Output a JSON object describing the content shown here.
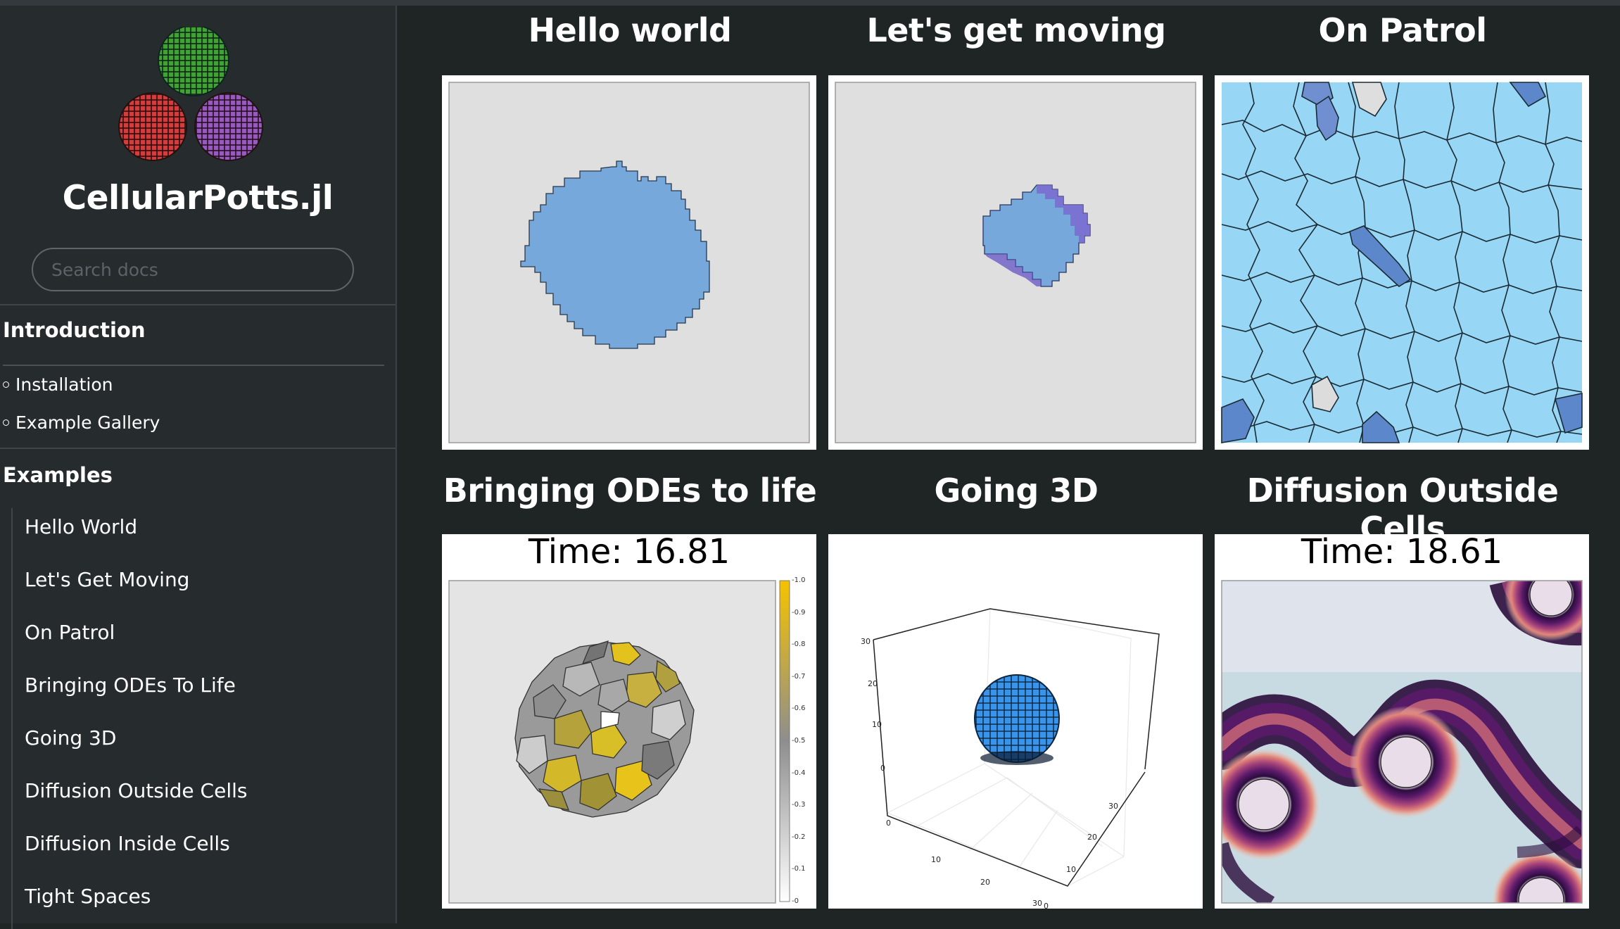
{
  "sidebar": {
    "package_name": "CellularPotts.jl",
    "search_placeholder": "Search docs",
    "intro": {
      "title": "Introduction",
      "items": [
        "Installation",
        "Example Gallery"
      ]
    },
    "examples": {
      "title": "Examples",
      "items": [
        "Hello World",
        "Let's Get Moving",
        "On Patrol",
        "Bringing ODEs To Life",
        "Going 3D",
        "Diffusion Outside Cells",
        "Diffusion Inside Cells",
        "Tight Spaces"
      ]
    }
  },
  "gallery": {
    "cards": [
      {
        "title": "Hello world"
      },
      {
        "title": "Let's get moving"
      },
      {
        "title": "On Patrol"
      },
      {
        "title": "Bringing ODEs to life",
        "time_label": "Time: 16.81",
        "colorbar_ticks": [
          "1.0",
          "0.9",
          "0.8",
          "0.7",
          "0.6",
          "0.5",
          "0.4",
          "0.3",
          "0.2",
          "0.1",
          "0"
        ]
      },
      {
        "title": "Going 3D",
        "axis_ticks": {
          "z": [
            "30",
            "20",
            "10",
            "0"
          ],
          "x": [
            "0",
            "10",
            "20",
            "30"
          ],
          "y": [
            "0",
            "10",
            "20",
            "30"
          ]
        }
      },
      {
        "title": "Diffusion Outside Cells",
        "time_label": "Time: 18.61"
      }
    ]
  },
  "colors": {
    "page_bg": "#1f2424",
    "sidebar_bg": "#262c2e",
    "cell_blue": "#77a8dc",
    "patrol_cell": "#97d6f5",
    "logo_green": "#3fa52e",
    "logo_red": "#d83b3a",
    "logo_purple": "#9a58c6"
  }
}
